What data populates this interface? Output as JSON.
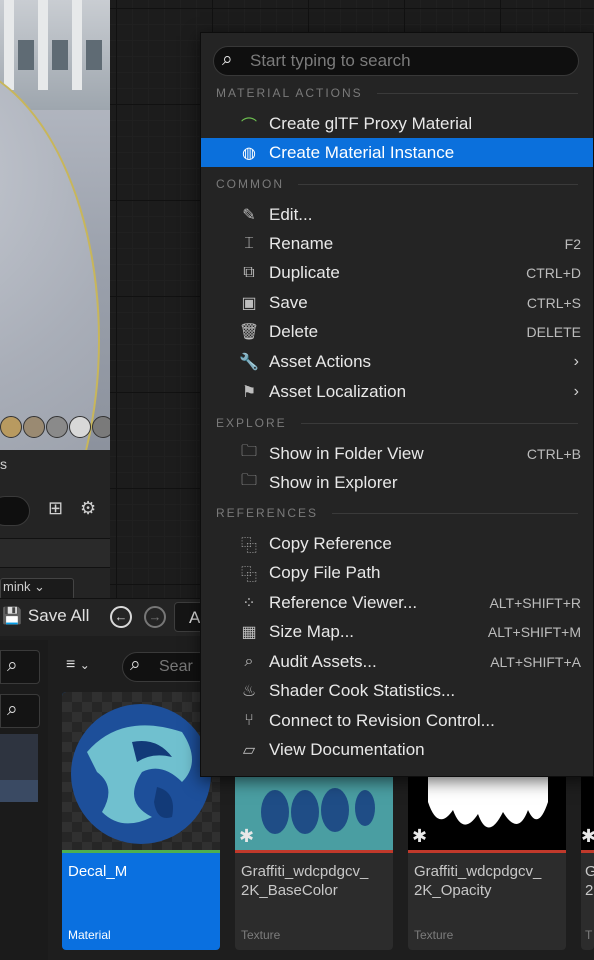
{
  "search": {
    "placeholder": "Start typing to search"
  },
  "menu": {
    "sections": {
      "material_actions": "MATERIAL ACTIONS",
      "common": "COMMON",
      "explore": "EXPLORE",
      "references": "REFERENCES"
    },
    "items": {
      "gltf_proxy": {
        "label": "Create glTF Proxy Material",
        "icon": "gltf-icon"
      },
      "material_instance": {
        "label": "Create Material Instance",
        "icon": "material-instance-icon"
      },
      "edit": {
        "label": "Edit...",
        "icon": "pencil-icon"
      },
      "rename": {
        "label": "Rename",
        "shortcut": "F2",
        "icon": "rename-icon"
      },
      "duplicate": {
        "label": "Duplicate",
        "shortcut": "CTRL+D",
        "icon": "duplicate-icon"
      },
      "save": {
        "label": "Save",
        "shortcut": "CTRL+S",
        "icon": "save-icon"
      },
      "delete": {
        "label": "Delete",
        "shortcut": "DELETE",
        "icon": "trash-icon"
      },
      "asset_actions": {
        "label": "Asset Actions",
        "icon": "wrench-icon"
      },
      "asset_localization": {
        "label": "Asset Localization",
        "icon": "flag-icon"
      },
      "show_folder": {
        "label": "Show in Folder View",
        "shortcut": "CTRL+B",
        "icon": "folder-search-icon"
      },
      "show_explorer": {
        "label": "Show in Explorer",
        "icon": "folder-search-icon"
      },
      "copy_reference": {
        "label": "Copy Reference",
        "icon": "copy-icon"
      },
      "copy_path": {
        "label": "Copy File Path",
        "icon": "copy-icon"
      },
      "reference_viewer": {
        "label": "Reference Viewer...",
        "shortcut": "ALT+SHIFT+R",
        "icon": "reference-viewer-icon"
      },
      "size_map": {
        "label": "Size Map...",
        "shortcut": "ALT+SHIFT+M",
        "icon": "size-map-icon"
      },
      "audit_assets": {
        "label": "Audit Assets...",
        "shortcut": "ALT+SHIFT+A",
        "icon": "audit-icon"
      },
      "shader_cook": {
        "label": "Shader Cook Statistics...",
        "icon": "shader-icon"
      },
      "revision_control": {
        "label": "Connect to Revision Control...",
        "icon": "branch-icon"
      },
      "view_docs": {
        "label": "View Documentation",
        "icon": "book-icon"
      }
    }
  },
  "toolbar": {
    "save_all": "Save All",
    "breadcrumb": "A",
    "asset_search_placeholder": "Sear"
  },
  "left_panel": {
    "title_fragment": "s",
    "dropdown_fragment": "mink ⌄"
  },
  "assets": [
    {
      "name": "Decal_M",
      "type": "Material",
      "selected": true
    },
    {
      "name": "Graffiti_wdcpdgcv_\n2K_BaseColor",
      "type": "Texture"
    },
    {
      "name": "Graffiti_wdcpdgcv_\n2K_Opacity",
      "type": "Texture"
    },
    {
      "name": "G\n2",
      "type": "T"
    }
  ],
  "colors": {
    "highlight": "#0b70dc",
    "menu_bg": "#242424",
    "material_bar": "#4caf50",
    "texture_bar": "#c0392b"
  }
}
